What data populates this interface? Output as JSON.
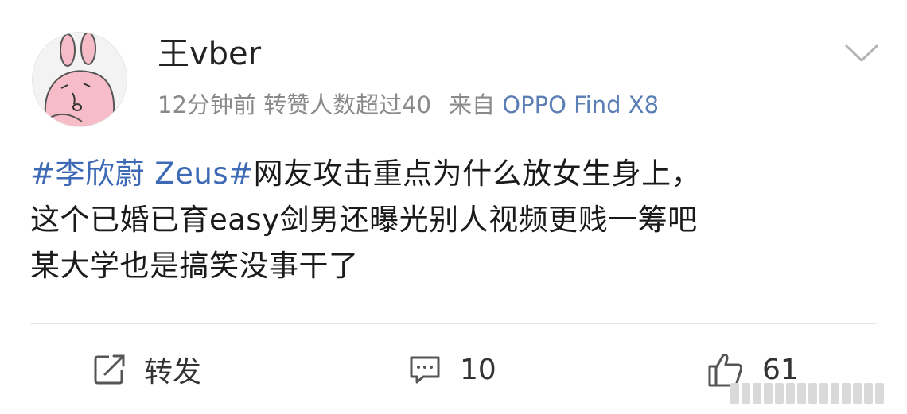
{
  "post": {
    "username": "王vber",
    "time": "12分钟前",
    "reposts_info": "转赞人数超过40",
    "source_prefix": "来自",
    "device": "OPPO Find X8",
    "hashtag": "#李欣蔚 Zeus#",
    "line1_rest": "网友攻击重点为什么放女生身上，",
    "line2": "这个已婚已育easy剑男还曝光别人视频更贱一筹吧",
    "line3": "某大学也是搞笑没事干了"
  },
  "actions": {
    "repost_label": "转发",
    "comment_count": "10",
    "like_count": "61"
  },
  "icons": {
    "menu": "chevron-down-icon",
    "repost": "repost-icon",
    "comment": "comment-icon",
    "like": "thumbs-up-icon"
  },
  "colors": {
    "link": "#3d69b5",
    "device": "#5b7fb5",
    "meta": "#8a8a8a"
  }
}
